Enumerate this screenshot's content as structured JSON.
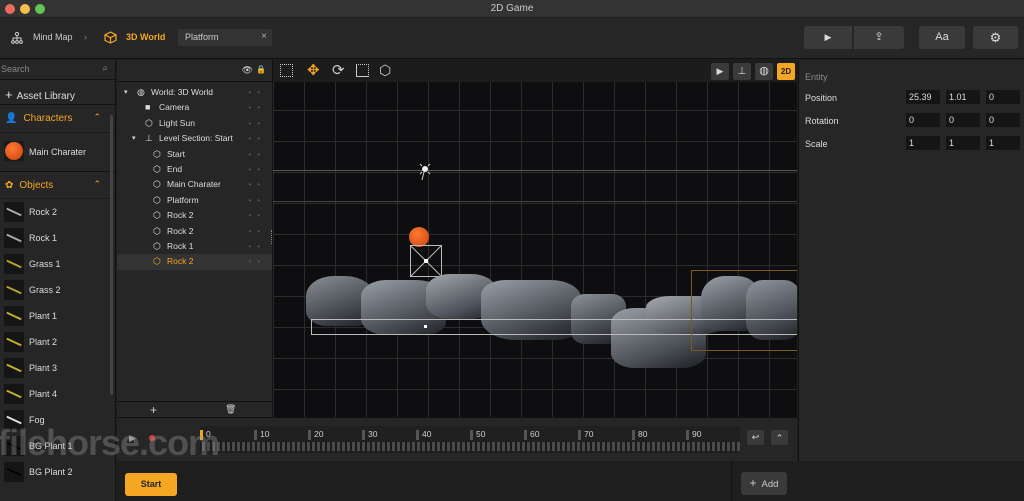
{
  "window": {
    "title": "2D Game",
    "traffic_colors": {
      "close": "#ed6a5e",
      "minimize": "#f4bf4f",
      "zoom": "#61c554"
    }
  },
  "accent": "#f5a623",
  "breadcrumb": {
    "items": [
      "Mind Map",
      "3D World"
    ],
    "separator": "›",
    "open_tab": "Platform",
    "tab_close": "×"
  },
  "toolbar_right": {
    "play": "▶",
    "share": "⇪",
    "font": "Aa",
    "settings": "⚙"
  },
  "sidebar": {
    "search_placeholder": "Search",
    "asset_library": "Asset Library",
    "characters": {
      "label": "Characters",
      "items": [
        {
          "label": "Main Charater"
        }
      ]
    },
    "objects": {
      "label": "Objects",
      "items": [
        {
          "label": "Rock 2",
          "color": "#aaaaaa"
        },
        {
          "label": "Rock 1",
          "color": "#aaaaaa"
        },
        {
          "label": "Grass 1",
          "color": "#b8a326"
        },
        {
          "label": "Grass 2",
          "color": "#b8a326"
        },
        {
          "label": "Plant 1",
          "color": "#c2b02a"
        },
        {
          "label": "Plant 2",
          "color": "#c2b02a"
        },
        {
          "label": "Plant 3",
          "color": "#c2b02a"
        },
        {
          "label": "Plant 4",
          "color": "#c2b02a"
        },
        {
          "label": "Fog",
          "color": "#dddddd"
        },
        {
          "label": "BG Plant 1",
          "color": "#050505"
        },
        {
          "label": "BG Plant 2",
          "color": "#050505"
        }
      ]
    }
  },
  "outliner": {
    "items": [
      {
        "label": "World: 3D World",
        "icon": "globe",
        "level": 0,
        "expand": "▾"
      },
      {
        "label": "Camera",
        "icon": "camera",
        "level": 1
      },
      {
        "label": "Light Sun",
        "icon": "hexagon",
        "level": 1
      },
      {
        "label": "Level Section: Start",
        "icon": "person",
        "level": 1,
        "expand": "▾"
      },
      {
        "label": "Start",
        "icon": "hexagon",
        "level": 2
      },
      {
        "label": "End",
        "icon": "hexagon",
        "level": 2
      },
      {
        "label": "Main Charater",
        "icon": "hexagon",
        "level": 2
      },
      {
        "label": "Platform",
        "icon": "hexagon",
        "level": 2
      },
      {
        "label": "Rock 2",
        "icon": "hexagon",
        "level": 2
      },
      {
        "label": "Rock 2",
        "icon": "hexagon",
        "level": 2
      },
      {
        "label": "Rock 1",
        "icon": "hexagon",
        "level": 2
      },
      {
        "label": "Rock 2",
        "icon": "hexagon",
        "level": 2,
        "selected": true
      }
    ],
    "add": "+",
    "delete": "🗑"
  },
  "view_mode": "2D",
  "properties": {
    "section": "Entity",
    "rows": [
      {
        "label": "Position",
        "values": [
          "25.39",
          "1.01",
          "0"
        ]
      },
      {
        "label": "Rotation",
        "values": [
          "0",
          "0",
          "0"
        ]
      },
      {
        "label": "Scale",
        "values": [
          "1",
          "1",
          "1"
        ]
      }
    ]
  },
  "timeline": {
    "ticks": [
      "0",
      "10",
      "20",
      "30",
      "40",
      "50",
      "60",
      "70",
      "80",
      "90"
    ],
    "current_frame": 0
  },
  "bottom": {
    "start": "Start",
    "add": "Add"
  },
  "watermark": "filehorse.com"
}
